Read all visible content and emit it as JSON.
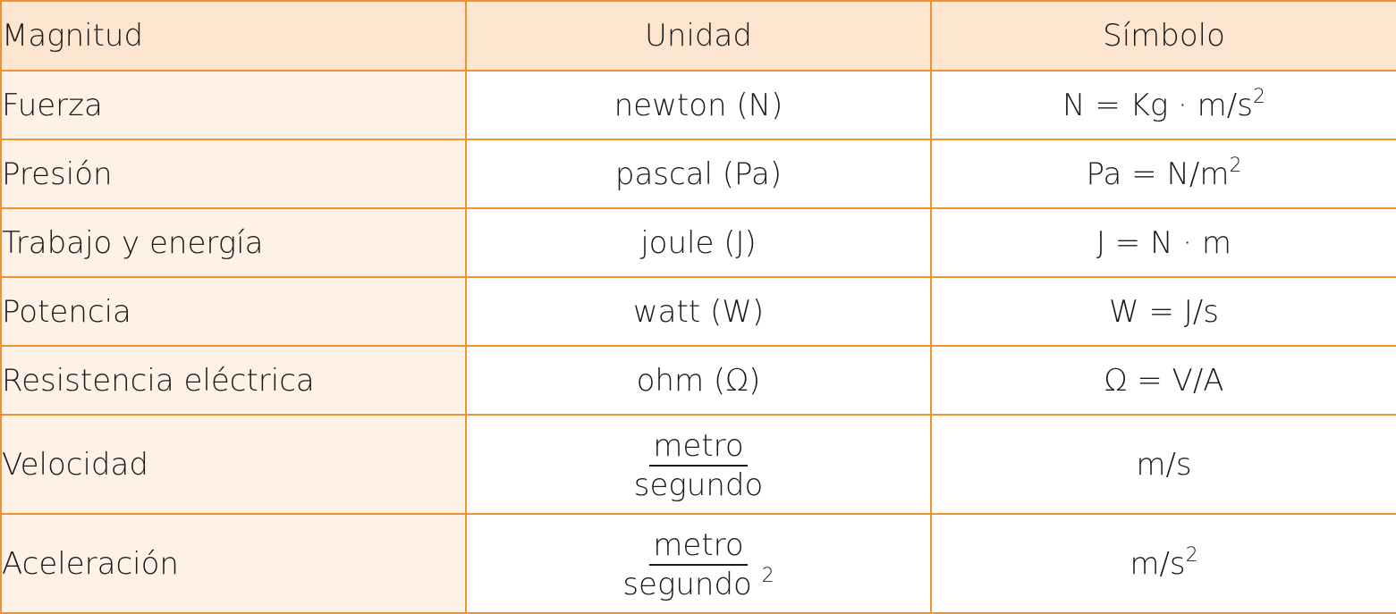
{
  "table": {
    "headers": [
      "Magnitud",
      "Unidad",
      "Símbolo"
    ],
    "rows": [
      {
        "magnitud": "Fuerza",
        "unidad": "newton (N)",
        "simbolo_base": "N = Kg · m/s",
        "simbolo_sup": "2"
      },
      {
        "magnitud": "Presión",
        "unidad": "pascal (Pa)",
        "simbolo_base": "Pa = N/m",
        "simbolo_sup": "2"
      },
      {
        "magnitud": "Trabajo y energía",
        "unidad": "joule (J)",
        "simbolo_base": "J = N · m",
        "simbolo_sup": ""
      },
      {
        "magnitud": "Potencia",
        "unidad": "watt (W)",
        "simbolo_base": "W = J/s",
        "simbolo_sup": ""
      },
      {
        "magnitud": "Resistencia eléctrica",
        "unidad": "ohm (Ω)",
        "simbolo_base": "Ω = V/A",
        "simbolo_sup": ""
      },
      {
        "magnitud": "Velocidad",
        "unidad_num": "metro",
        "unidad_den": "segundo",
        "unidad_den_sup": "",
        "simbolo_base": "m/s",
        "simbolo_sup": ""
      },
      {
        "magnitud": "Aceleración",
        "unidad_num": "metro",
        "unidad_den": "segundo",
        "unidad_den_sup": "2",
        "simbolo_base": "m/s",
        "simbolo_sup": "2"
      }
    ]
  },
  "colors": {
    "border": "#f0922e",
    "header_bg": "#fde5cf",
    "first_col_bg": "#fef1e6"
  }
}
